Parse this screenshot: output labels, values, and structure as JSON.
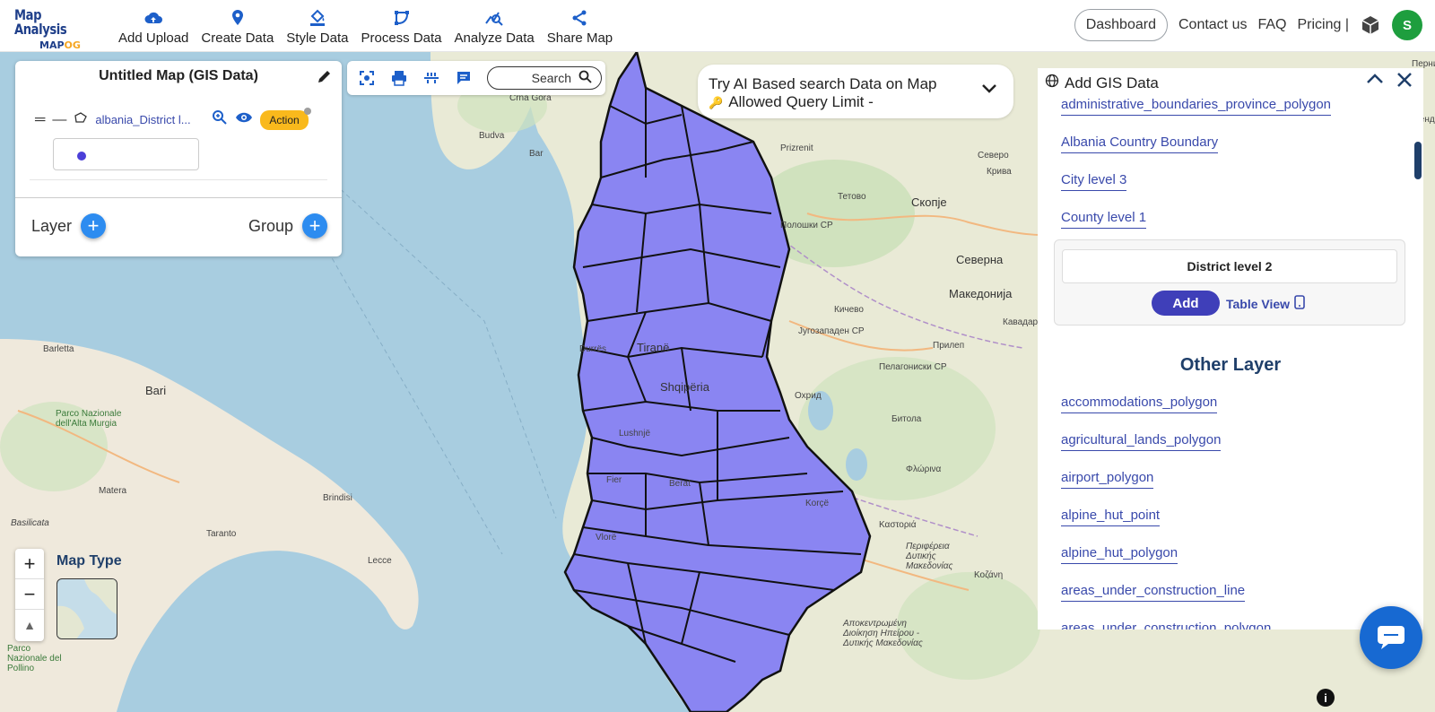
{
  "app": {
    "logo_line1": "Map Analysis",
    "logo_line2_a": "MAP",
    "logo_line2_b": "OG"
  },
  "nav": [
    {
      "label": "Add Upload",
      "icon": "cloud-upload-icon"
    },
    {
      "label": "Create Data",
      "icon": "map-pin-icon"
    },
    {
      "label": "Style Data",
      "icon": "paint-bucket-icon"
    },
    {
      "label": "Process Data",
      "icon": "process-icon"
    },
    {
      "label": "Analyze Data",
      "icon": "analyze-icon"
    },
    {
      "label": "Share Map",
      "icon": "share-icon"
    }
  ],
  "header_right": {
    "dashboard": "Dashboard",
    "contact": "Contact us",
    "faq": "FAQ",
    "pricing": "Pricing |",
    "avatar_initial": "S"
  },
  "left_panel": {
    "title": "Untitled Map (GIS Data)",
    "layer_name": "albania_District l...",
    "action_label": "Action",
    "layer_label": "Layer",
    "group_label": "Group",
    "fill_color": "#4b3fd8"
  },
  "toolbar": {
    "search_label": "Search"
  },
  "ai_search": {
    "line1": "Try AI Based search Data on Map",
    "line2": "Allowed Query Limit -"
  },
  "right_panel": {
    "title": "Add GIS Data",
    "top_links": [
      "administrative_boundaries_province_polygon",
      "Albania Country Boundary",
      "City level 3",
      "County level 1"
    ],
    "card_title": "District level 2",
    "add_label": "Add",
    "table_view_label": "Table View",
    "other_title": "Other Layer",
    "other_links": [
      "accommodations_polygon",
      "agricultural_lands_polygon",
      "airport_polygon",
      "alpine_hut_point",
      "alpine_hut_polygon",
      "areas_under_construction_line",
      "areas_under_construction_polygon"
    ]
  },
  "map": {
    "labels": {
      "crna_gora": "Crna Gora",
      "budva": "Budva",
      "bar": "Bar",
      "prizrenit": "Prizrenit",
      "tetovo": "Тетово",
      "skopje": "Скопје",
      "polog": "Полошки СР",
      "severna": "Северна",
      "makedonija": "Македонија",
      "kicevo": "Кичево",
      "prilep": "Прилеп",
      "jugozapaden": "Југозападен СР",
      "pelagoniski": "Пелагониски СР",
      "ohrid": "Охрид",
      "bitola": "Битола",
      "florina": "Φλώρινα",
      "kastoria": "Καστοριά",
      "tirane": "Tiranë",
      "shqiperia": "Shqipëria",
      "durres": "Durrës",
      "lushnje": "Lushnjë",
      "fier": "Fier",
      "berat": "Berat",
      "korce": "Korçë",
      "vlore": "Vlorë",
      "barletta": "Barletta",
      "bari": "Bari",
      "parco_alta_murgia": "Parco Nazionale dell'Alta Murgia",
      "matera": "Matera",
      "brindisi": "Brindisi",
      "taranto": "Taranto",
      "lecce": "Lecce",
      "basilicata": "Basilicata",
      "parco_pollino": "Parco Nazionale del Pollino",
      "kozani": "Κοζάνη",
      "dytiki": "Αποκεντρωμένη Διοίκηση Ηπείρου - Δυτικής Μακεδονίας",
      "periferia": "Περιφέρεια Δυτικής Μακεδονίας",
      "kavadarci": "Кавадар",
      "pernik": "Перник",
      "kyustendil": "Кюстендил",
      "severo": "Северо",
      "kriva": "Крива"
    }
  },
  "map_controls": {
    "zoom_in": "+",
    "zoom_out": "−",
    "reset": "▲",
    "map_type_label": "Map Type"
  },
  "info_icon": "i"
}
